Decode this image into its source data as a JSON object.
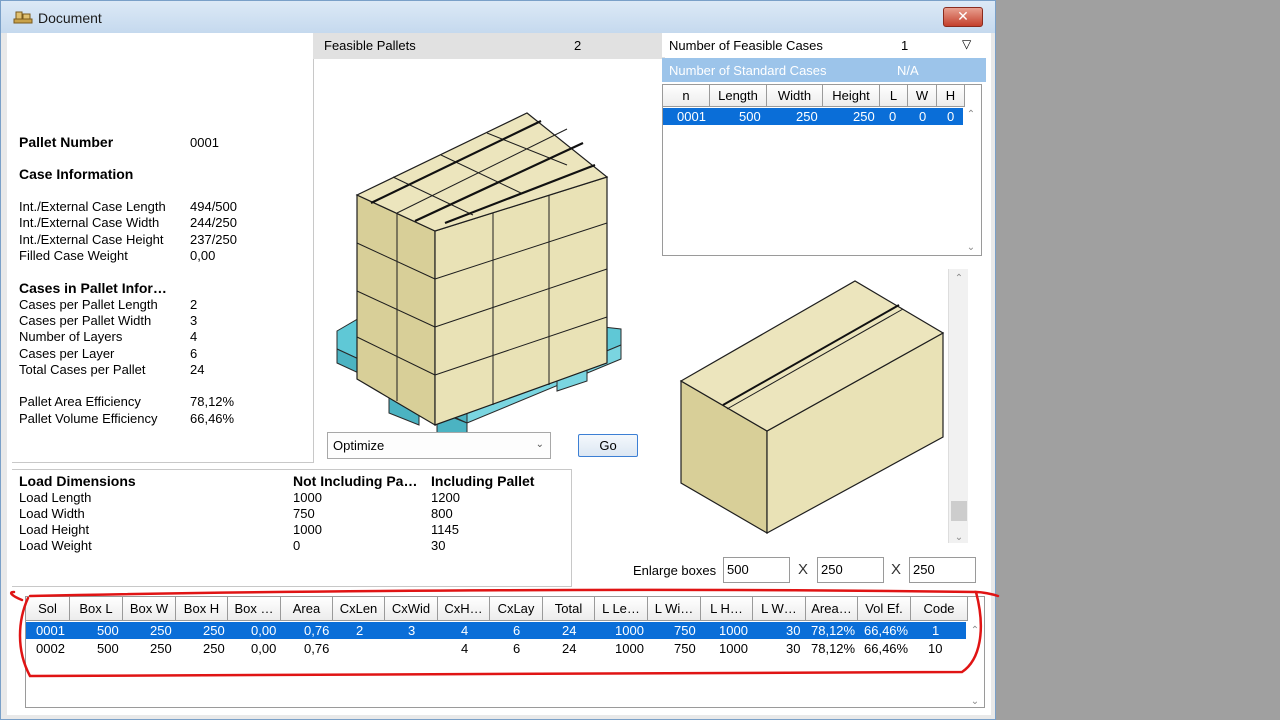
{
  "window": {
    "title": "Document",
    "close_glyph": "✕"
  },
  "info": {
    "pallet_number_label": "Pallet Number",
    "pallet_number": "0001",
    "case_info_heading": "Case Information",
    "case_rows": [
      {
        "label": "Int./External Case Length",
        "value": "494/500"
      },
      {
        "label": "Int./External Case Width",
        "value": "244/250"
      },
      {
        "label": "Int./External Case Height",
        "value": "237/250"
      },
      {
        "label": "Filled Case Weight",
        "value": "0,00"
      }
    ],
    "pallet_info_heading": "Cases in Pallet Infor…",
    "pallet_rows": [
      {
        "label": "Cases per Pallet Length",
        "value": "2"
      },
      {
        "label": "Cases per Pallet Width",
        "value": "3"
      },
      {
        "label": "Number of Layers",
        "value": "4"
      },
      {
        "label": "Cases per Layer",
        "value": "6"
      },
      {
        "label": "Total Cases per Pallet",
        "value": "24"
      }
    ],
    "efficiency_rows": [
      {
        "label": "Pallet Area Efficiency",
        "value": "78,12%"
      },
      {
        "label": "Pallet Volume Efficiency",
        "value": "66,46%"
      }
    ]
  },
  "feasible_pallets": {
    "label": "Feasible Pallets",
    "count": "2"
  },
  "optimize": {
    "value": "Optimize",
    "go_label": "Go"
  },
  "feasible_cases": {
    "label": "Number of Feasible Cases",
    "value": "1",
    "dropdown_glyph": "▽"
  },
  "standard_cases": {
    "label": "Number of Standard Cases",
    "value": "N/A"
  },
  "cases_table": {
    "headers": [
      "n",
      "Length",
      "Width",
      "Height",
      "L",
      "W",
      "H"
    ],
    "row": [
      "0001",
      "500",
      "250",
      "250",
      "0",
      "0",
      "0"
    ]
  },
  "enlarge": {
    "label": "Enlarge boxes",
    "length": "500",
    "width": "250",
    "height": "250",
    "times_glyph": "X"
  },
  "load": {
    "heading": "Load Dimensions",
    "col_not_incl": "Not Including Pa…",
    "col_incl": "Including Pallet",
    "rows": [
      {
        "label": "Load Length",
        "not_incl": "1000",
        "incl": "1200"
      },
      {
        "label": "Load Width",
        "not_incl": "750",
        "incl": "800"
      },
      {
        "label": "Load Height",
        "not_incl": "1000",
        "incl": "1145"
      },
      {
        "label": "Load Weight",
        "not_incl": "0",
        "incl": "30"
      }
    ]
  },
  "solutions": {
    "headers": [
      "Sol",
      "Box L",
      "Box W",
      "Box H",
      "Box …",
      "Area",
      "CxLen",
      "CxWid",
      "CxH…",
      "CxLay",
      "Total",
      "L Le…",
      "L Wi…",
      "L H…",
      "L W…",
      "Area…",
      "Vol Ef.",
      "Code"
    ],
    "rows": [
      [
        "0001",
        "500",
        "250",
        "250",
        "0,00",
        "0,76",
        "2",
        "3",
        "4",
        "6",
        "24",
        "1000",
        "750",
        "1000",
        "30",
        "78,12%",
        "66,46%",
        "1"
      ],
      [
        "0002",
        "500",
        "250",
        "250",
        "0,00",
        "0,76",
        "",
        "",
        "4",
        "6",
        "24",
        "1000",
        "750",
        "1000",
        "30",
        "78,12%",
        "66,46%",
        "10"
      ]
    ]
  },
  "colors": {
    "selection": "#0a6ed8",
    "box_face": "#e9e2b6",
    "pallet": "#5fc8d6",
    "annotation": "#e01414"
  },
  "icons": [
    "pallet-app-icon",
    "close-icon",
    "dropdown-arrow-icon",
    "scroll-up-icon",
    "scroll-down-icon"
  ]
}
